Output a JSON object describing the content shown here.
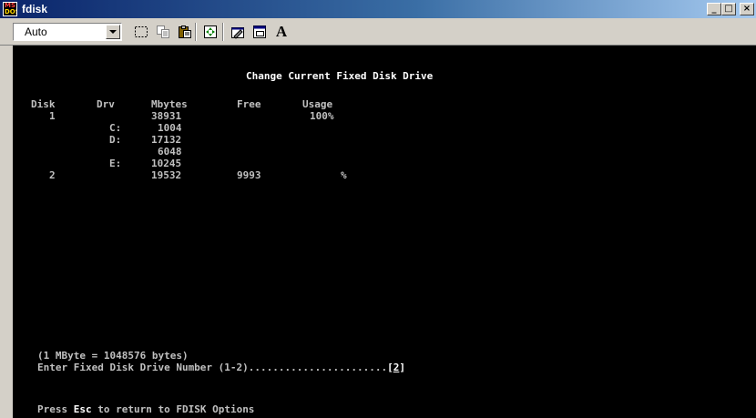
{
  "window": {
    "title": "fdisk",
    "icon_top": "MS",
    "icon_bottom": "DOS",
    "buttons": {
      "minimize": "_",
      "maximize": "□",
      "close": "×"
    }
  },
  "toolbar": {
    "font_size_value": "Auto",
    "font_button_label": "A",
    "icons": [
      "mark-icon",
      "copy-icon",
      "paste-icon",
      "fullscreen-icon",
      "properties-icon",
      "background-icon",
      "font-icon"
    ]
  },
  "screen": {
    "heading": "Change Current Fixed Disk Drive",
    "columns": {
      "disk": "Disk",
      "drv": "Drv",
      "mbytes": "Mbytes",
      "free": "Free",
      "usage": "Usage"
    },
    "rows": [
      {
        "disk": "1",
        "drv": "",
        "mbytes": "38931",
        "free": "",
        "usage": "100%"
      },
      {
        "disk": "",
        "drv": "C:",
        "mbytes": "1004",
        "free": "",
        "usage": ""
      },
      {
        "disk": "",
        "drv": "D:",
        "mbytes": "17132",
        "free": "",
        "usage": ""
      },
      {
        "disk": "",
        "drv": "",
        "mbytes": "6048",
        "free": "",
        "usage": ""
      },
      {
        "disk": "",
        "drv": "E:",
        "mbytes": "10245",
        "free": "",
        "usage": ""
      },
      {
        "disk": "2",
        "drv": "",
        "mbytes": "19532",
        "free": "9993",
        "usage": "%"
      }
    ],
    "mbyte_note": "(1 MByte = 1048576 bytes)",
    "prompt_text": "Enter Fixed Disk Drive Number (1-2).......................",
    "prompt_open": "[",
    "prompt_value": "2",
    "prompt_close": "]",
    "footer_press": "Press ",
    "footer_key": "Esc",
    "footer_rest": " to return to FDISK Options"
  }
}
